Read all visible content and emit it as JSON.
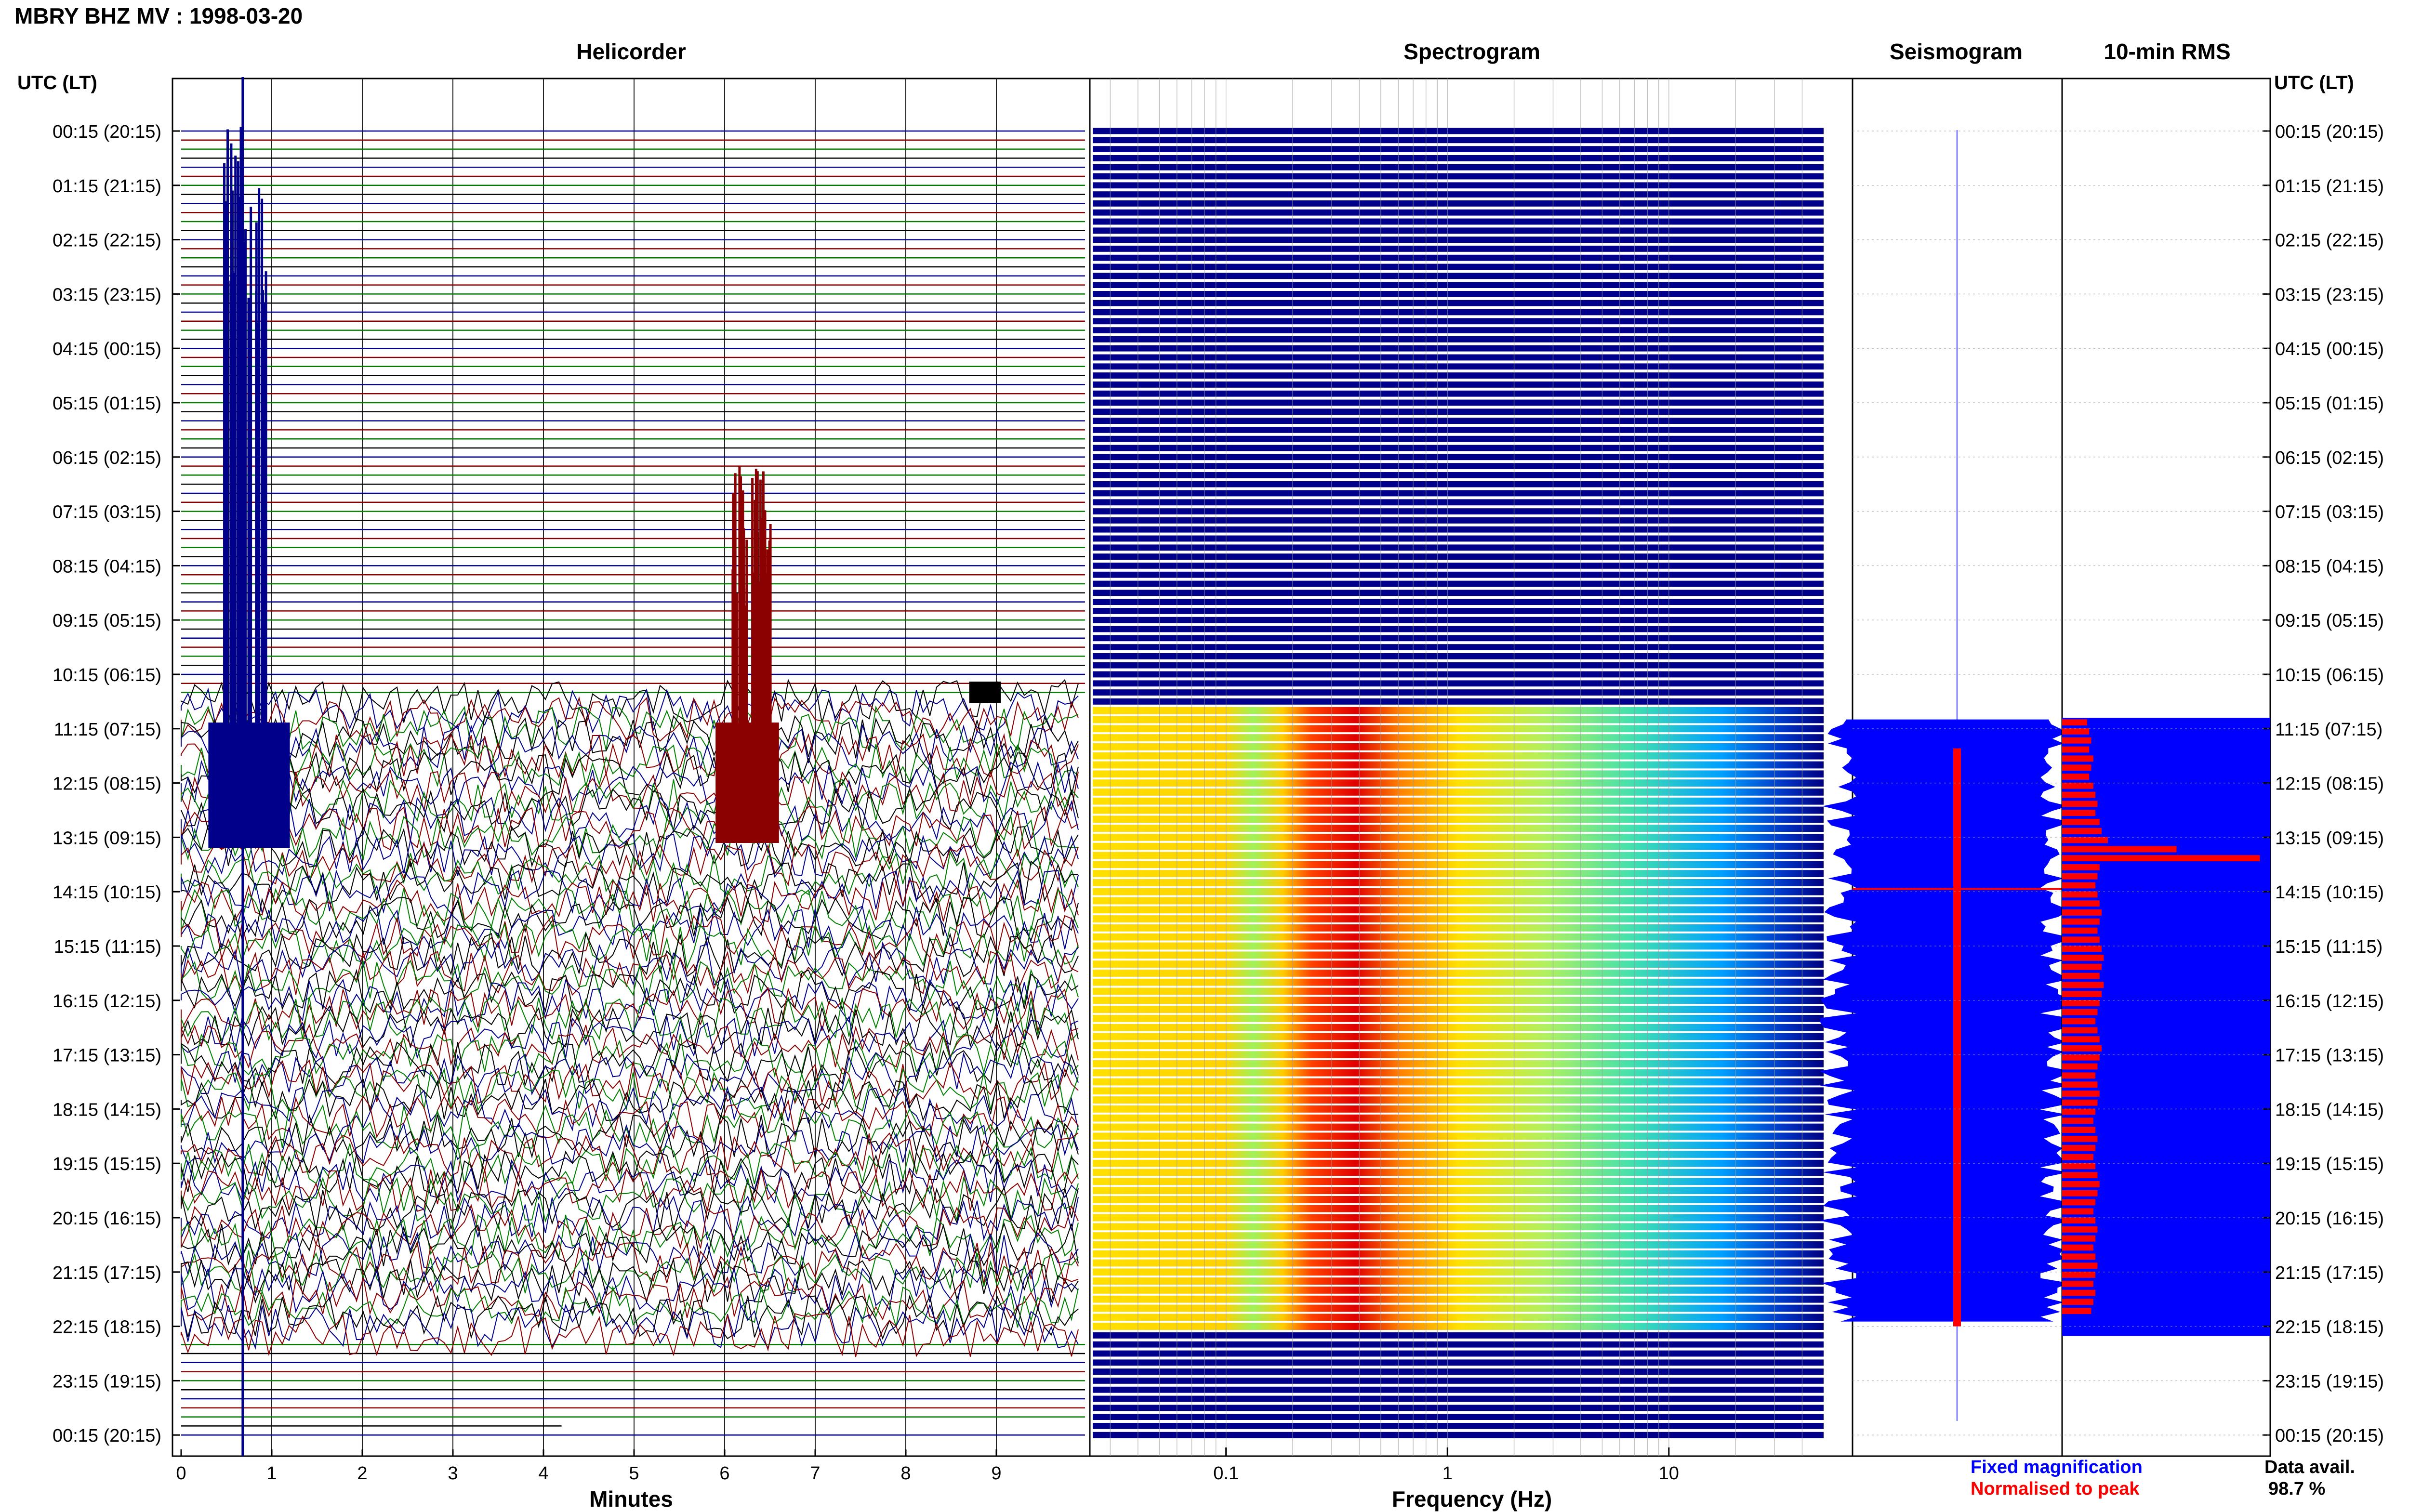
{
  "header": {
    "title": "MBRY BHZ MV : 1998-03-20",
    "utc_label_left": "UTC (LT)",
    "utc_label_right": "UTC (LT)"
  },
  "panels": {
    "helicorder": "Helicorder",
    "spectrogram": "Spectrogram",
    "seismogram": "Seismogram",
    "rms": "10-min RMS"
  },
  "axes": {
    "helicorder_xlabel": "Minutes",
    "spectrogram_xlabel": "Frequency (Hz)"
  },
  "legend": {
    "fixed": "Fixed magnification",
    "normalised": "Normalised to peak"
  },
  "availability": {
    "label": "Data avail.",
    "value": "98.7 %"
  },
  "colors": {
    "blue": "#00008b",
    "red": "#8b0000",
    "green": "#008000",
    "black": "#000000",
    "legend_blue": "#0000ff",
    "legend_red": "#ff0000"
  },
  "chart_data": {
    "type": "heatmap",
    "time_labels": [
      "00:15 (20:15)",
      "01:15 (21:15)",
      "02:15 (22:15)",
      "03:15 (23:15)",
      "04:15 (00:15)",
      "05:15 (01:15)",
      "06:15 (02:15)",
      "07:15 (03:15)",
      "08:15 (04:15)",
      "09:15 (05:15)",
      "10:15 (06:15)",
      "11:15 (07:15)",
      "12:15 (08:15)",
      "13:15 (09:15)",
      "14:15 (10:15)",
      "15:15 (11:15)",
      "16:15 (12:15)",
      "17:15 (13:15)",
      "18:15 (14:15)",
      "19:15 (15:15)",
      "20:15 (16:15)",
      "21:15 (17:15)",
      "22:15 (18:15)",
      "23:15 (19:15)",
      "00:15 (20:15)"
    ],
    "helicorder_xticks": [
      "0",
      "1",
      "2",
      "3",
      "4",
      "5",
      "6",
      "7",
      "8",
      "9"
    ],
    "helicorder_xlim": [
      0,
      10
    ],
    "spectrogram_xticks": [
      "0.1",
      "1",
      "10"
    ],
    "spectrogram_xscale": "log",
    "spectrogram_xlim": [
      0.025,
      50
    ],
    "data_start_utc": "11:05",
    "data_end_utc": "22:15",
    "rms_red_values": [
      0.12,
      0.13,
      0.14,
      0.13,
      0.15,
      0.14,
      0.13,
      0.15,
      0.16,
      0.17,
      0.16,
      0.18,
      0.19,
      0.22,
      0.55,
      0.95,
      0.18,
      0.17,
      0.16,
      0.17,
      0.18,
      0.19,
      0.18,
      0.17,
      0.18,
      0.19,
      0.2,
      0.19,
      0.18,
      0.2,
      0.19,
      0.18,
      0.17,
      0.16,
      0.17,
      0.18,
      0.19,
      0.18,
      0.17,
      0.16,
      0.17,
      0.18,
      0.17,
      0.16,
      0.15,
      0.16,
      0.17,
      0.16,
      0.15,
      0.16,
      0.17,
      0.18,
      0.17,
      0.16,
      0.15,
      0.16,
      0.17,
      0.16,
      0.15,
      0.16,
      0.17,
      0.16,
      0.15,
      0.16,
      0.15,
      0.14
    ]
  }
}
